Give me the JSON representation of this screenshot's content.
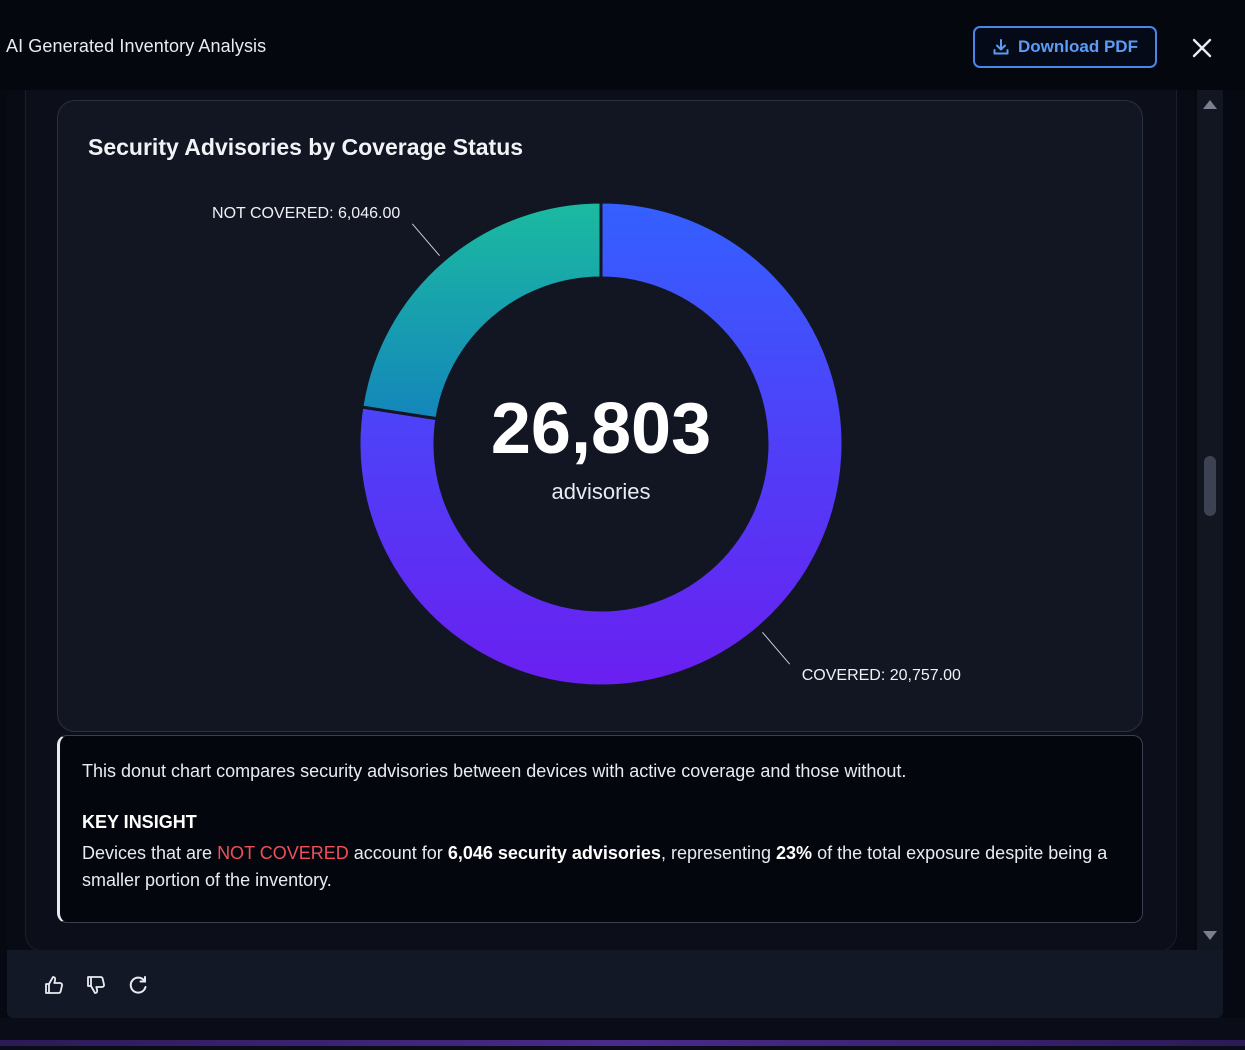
{
  "header": {
    "title": "AI Generated Inventory Analysis",
    "download_label": "Download PDF",
    "download_icon": "download-icon",
    "close_icon": "close-icon"
  },
  "chart_card": {
    "title": "Security Advisories by Coverage Status"
  },
  "chart_data": {
    "type": "pie",
    "title": "Security Advisories by Coverage Status",
    "categories": [
      "COVERED",
      "NOT COVERED"
    ],
    "values": [
      20757.0,
      6046.0
    ],
    "slice_labels": [
      "COVERED: 20,757.00",
      "NOT COVERED: 6,046.00"
    ],
    "colors": [
      "#3a5cff",
      "#17b3a3"
    ],
    "center_value": "26,803",
    "center_label": "advisories"
  },
  "insight": {
    "description": "This donut chart compares security advisories between devices with active coverage and those without.",
    "heading": "KEY INSIGHT",
    "body_1": "Devices that are ",
    "highlight": "NOT COVERED",
    "body_2": " account for ",
    "bold_1": "6,046 security advisories",
    "body_3": ", representing ",
    "bold_2": "23%",
    "body_4": " of the total exposure despite being a smaller portion of the inventory."
  },
  "footer_actions": [
    "thumbs-up-icon",
    "thumbs-down-icon",
    "refresh-icon"
  ],
  "colors": {
    "accent_blue": "#4a86e8",
    "not_covered_red": "#ef4f5a",
    "covered_gradient_top": "#3a5cff",
    "covered_gradient_bottom": "#6a1ff0",
    "not_covered_gradient_top": "#1bb89e",
    "not_covered_gradient_bottom": "#1488b8"
  }
}
